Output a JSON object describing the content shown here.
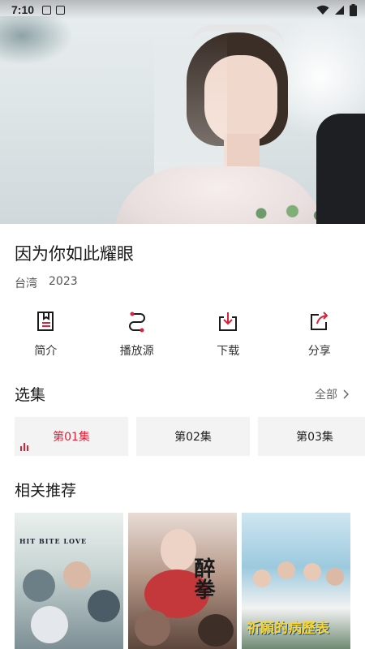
{
  "status_bar": {
    "time": "7:10"
  },
  "player": {
    "thumbnail": "wedding-scene-bride"
  },
  "show": {
    "title": "因为你如此耀眼",
    "region": "台湾",
    "year": "2023"
  },
  "actions": [
    {
      "label": "简介",
      "icon": "document-icon"
    },
    {
      "label": "播放源",
      "icon": "route-icon"
    },
    {
      "label": "下载",
      "icon": "download-icon"
    },
    {
      "label": "分享",
      "icon": "share-icon"
    }
  ],
  "episodes": {
    "heading": "选集",
    "all_label": "全部",
    "items": [
      {
        "label": "第01集",
        "active": true
      },
      {
        "label": "第02集",
        "active": false
      },
      {
        "label": "第03集",
        "active": false
      }
    ]
  },
  "recommendations": {
    "heading": "相关推荐",
    "items": [
      {
        "poster_text": "HIT BITE LOVE"
      },
      {
        "poster_text": "醉拳"
      },
      {
        "poster_text": "祈願的病歷表"
      }
    ]
  },
  "colors": {
    "accent": "#d9233b",
    "episode_bg": "#f3f3f3"
  }
}
